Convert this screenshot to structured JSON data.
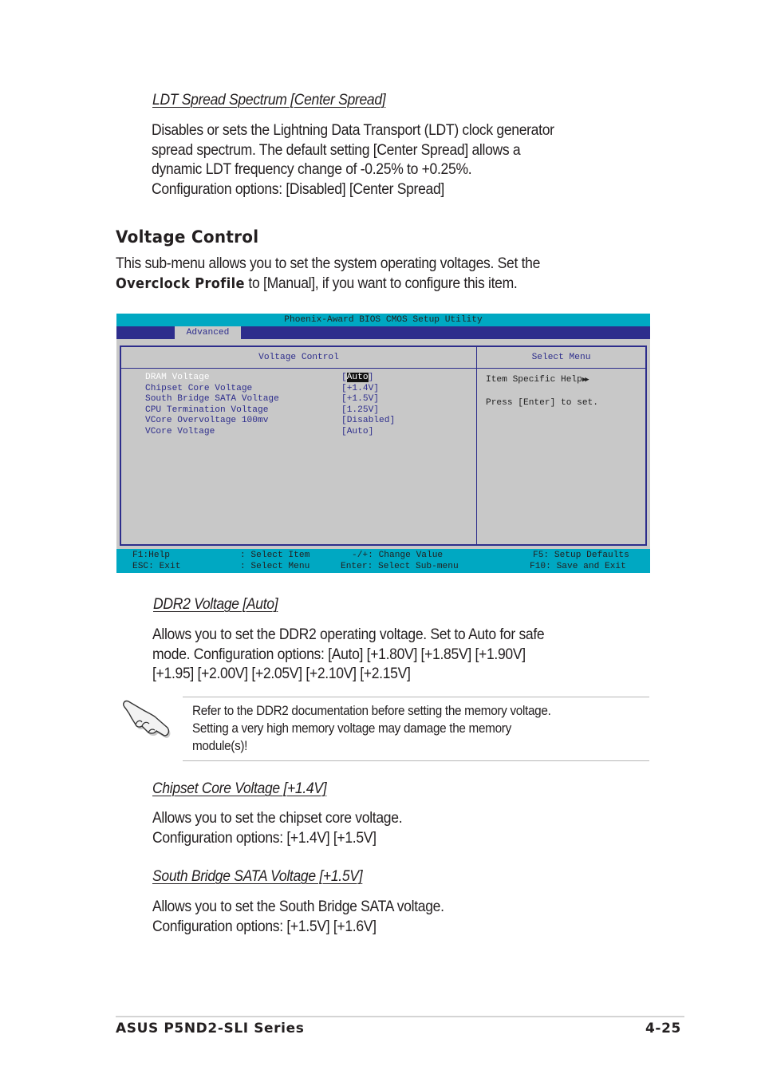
{
  "ldt": {
    "heading": "LDT Spread Spectrum [Center Spread]",
    "lines": [
      "Disables or sets the Lightning Data Transport (LDT) clock generator",
      "spread spectrum. The default setting [Center Spread] allows a",
      "dynamic LDT frequency change of -0.25% to +0.25%.",
      "Configuration options: [Disabled] [Center Spread]"
    ]
  },
  "voltage_control": {
    "title": "Voltage Control",
    "intro_line1": "This sub-menu allows you to set the system operating voltages. Set the",
    "intro_bold": "Overclock Profile",
    "intro_line2_rest": " to [Manual], if you want to configure this item."
  },
  "bios": {
    "title": "Phoenix-Award BIOS CMOS Setup Utility",
    "tab": "Advanced",
    "left_header": "Voltage Control",
    "right_header": "Select Menu",
    "items": [
      {
        "label": "DRAM Voltage",
        "value": "Auto",
        "selected": true
      },
      {
        "label": "Chipset Core Voltage",
        "value": "+1.4V",
        "selected": false
      },
      {
        "label": "South Bridge SATA Voltage",
        "value": "+1.5V",
        "selected": false
      },
      {
        "label": "CPU Termination Voltage",
        "value": "1.25V",
        "selected": false
      },
      {
        "label": "VCore Overvoltage 100mv",
        "value": "Disabled",
        "selected": false
      },
      {
        "label": "VCore Voltage",
        "value": "Auto",
        "selected": false
      }
    ],
    "help_title": "Item Specific Help",
    "help_arrow": "▶▶",
    "help_text": "Press [Enter] to set.",
    "footer": {
      "f1": "F1:Help",
      "select_item": ": Select Item",
      "change_value": "-/+: Change Value",
      "f5": "F5: Setup Defaults",
      "esc": "ESC: Exit",
      "select_menu": ": Select Menu",
      "enter": "Enter: Select Sub-menu",
      "f10": "F10: Save and Exit"
    },
    "colors": {
      "cyan_bar": "#00a8c2",
      "navy": "#2d2d8c",
      "panel_gray": "#c8c8c8"
    }
  },
  "ddr2": {
    "heading": "DDR2 Voltage [Auto]",
    "lines": [
      "Allows you to set the DDR2 operating voltage. Set to Auto for safe",
      "mode. Configuration options: [Auto] [+1.80V] [+1.85V] [+1.90V]",
      "[+1.95] [+2.00V] [+2.05V] [+2.10V] [+2.15V]"
    ]
  },
  "note": {
    "icon": "hand-pointing-icon",
    "lines": [
      "Refer to the DDR2 documentation before setting the memory voltage.",
      "Setting a very high memory voltage may damage the memory",
      "module(s)!"
    ]
  },
  "chipset": {
    "heading": "Chipset Core Voltage [+1.4V]",
    "lines": [
      "Allows you to set the chipset core voltage.",
      "Configuration options: [+1.4V] [+1.5V]"
    ]
  },
  "southbridge": {
    "heading": "South Bridge SATA Voltage [+1.5V]",
    "lines": [
      "Allows you to set the South Bridge SATA voltage.",
      "Configuration options: [+1.5V] [+1.6V]"
    ]
  },
  "page_footer": {
    "product": "ASUS P5ND2-SLI Series",
    "page_number": "4-25"
  }
}
